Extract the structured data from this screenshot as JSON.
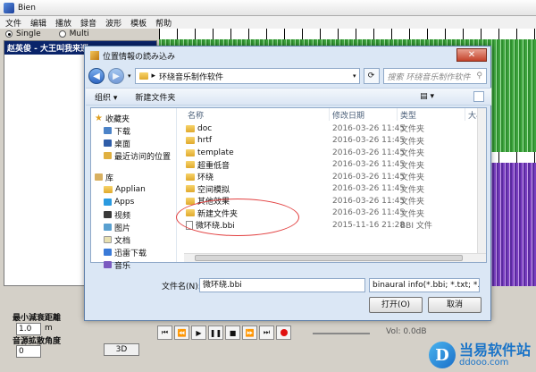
{
  "app": {
    "title": "Bien",
    "menu": [
      "文件",
      "编辑",
      "播放",
      "録音",
      "波形",
      "模板",
      "帮助"
    ],
    "modes": {
      "single": "Single",
      "multi": "Multi",
      "selected": "Single"
    },
    "track_name": "赵英俊 - 大王叫我来巡",
    "label_min_dist": "最小減衰距離",
    "min_dist_value": "1.0",
    "min_dist_unit": "m",
    "label_angle": "音源拡散角度",
    "angle_value": "0",
    "btn_3d": "3D",
    "vol_label": "Vol: 0.0dB",
    "transport": {
      "first": "⏮",
      "rewind": "⏪",
      "play": "▶",
      "pause": "❚❚",
      "stop": "■",
      "forward": "⏩",
      "last": "⏭"
    },
    "colors": {
      "green_wave": "#3fa53f",
      "purple_wave": "#7a3fc0",
      "selection": "#0a246a"
    }
  },
  "dialog": {
    "title": "位置情報の読み込み",
    "close_label": "✕",
    "breadcrumb": "环绕音乐制作软件",
    "search_placeholder": "搜索 环绕音乐制作软件",
    "toolbar": {
      "organize": "组织 ▾",
      "new_folder": "新建文件夹"
    },
    "nav": {
      "favorites": "收藏夹",
      "download": "下载",
      "desktop": "桌面",
      "recent": "最近访问的位置",
      "library": "库",
      "applian": "Applian",
      "apps": "Apps",
      "video": "视频",
      "pictures": "图片",
      "documents": "文档",
      "thunder": "迅雷下载",
      "music": "音乐"
    },
    "columns": {
      "name": "名称",
      "modified": "修改日期",
      "type": "类型",
      "size": "大小"
    },
    "files": [
      {
        "name": "doc",
        "date": "2016-03-26 11:45",
        "type": "文件夹"
      },
      {
        "name": "hrtf",
        "date": "2016-03-26 11:45",
        "type": "文件夹"
      },
      {
        "name": "template",
        "date": "2016-03-26 11:45",
        "type": "文件夹"
      },
      {
        "name": "超重低音",
        "date": "2016-03-26 11:45",
        "type": "文件夹"
      },
      {
        "name": "环绕",
        "date": "2016-03-26 11:45",
        "type": "文件夹"
      },
      {
        "name": "空间模拟",
        "date": "2016-03-26 11:45",
        "type": "文件夹"
      },
      {
        "name": "其他效果",
        "date": "2016-03-26 11:45",
        "type": "文件夹"
      },
      {
        "name": "新建文件夹",
        "date": "2016-03-26 11:45",
        "type": "文件夹"
      },
      {
        "name": "微环绕.bbi",
        "date": "2015-11-16 21:28",
        "type": "BBI 文件"
      }
    ],
    "filename_label": "文件名(N):",
    "filename_value": "微环绕.bbi",
    "filetype_value": "binaural info(*.bbi; *.txt; *.btp",
    "open_button": "打开(O)",
    "cancel_button": "取消"
  },
  "watermark": {
    "logo_letter": "D",
    "text": "当易软件站",
    "url": "ddooo.com"
  }
}
